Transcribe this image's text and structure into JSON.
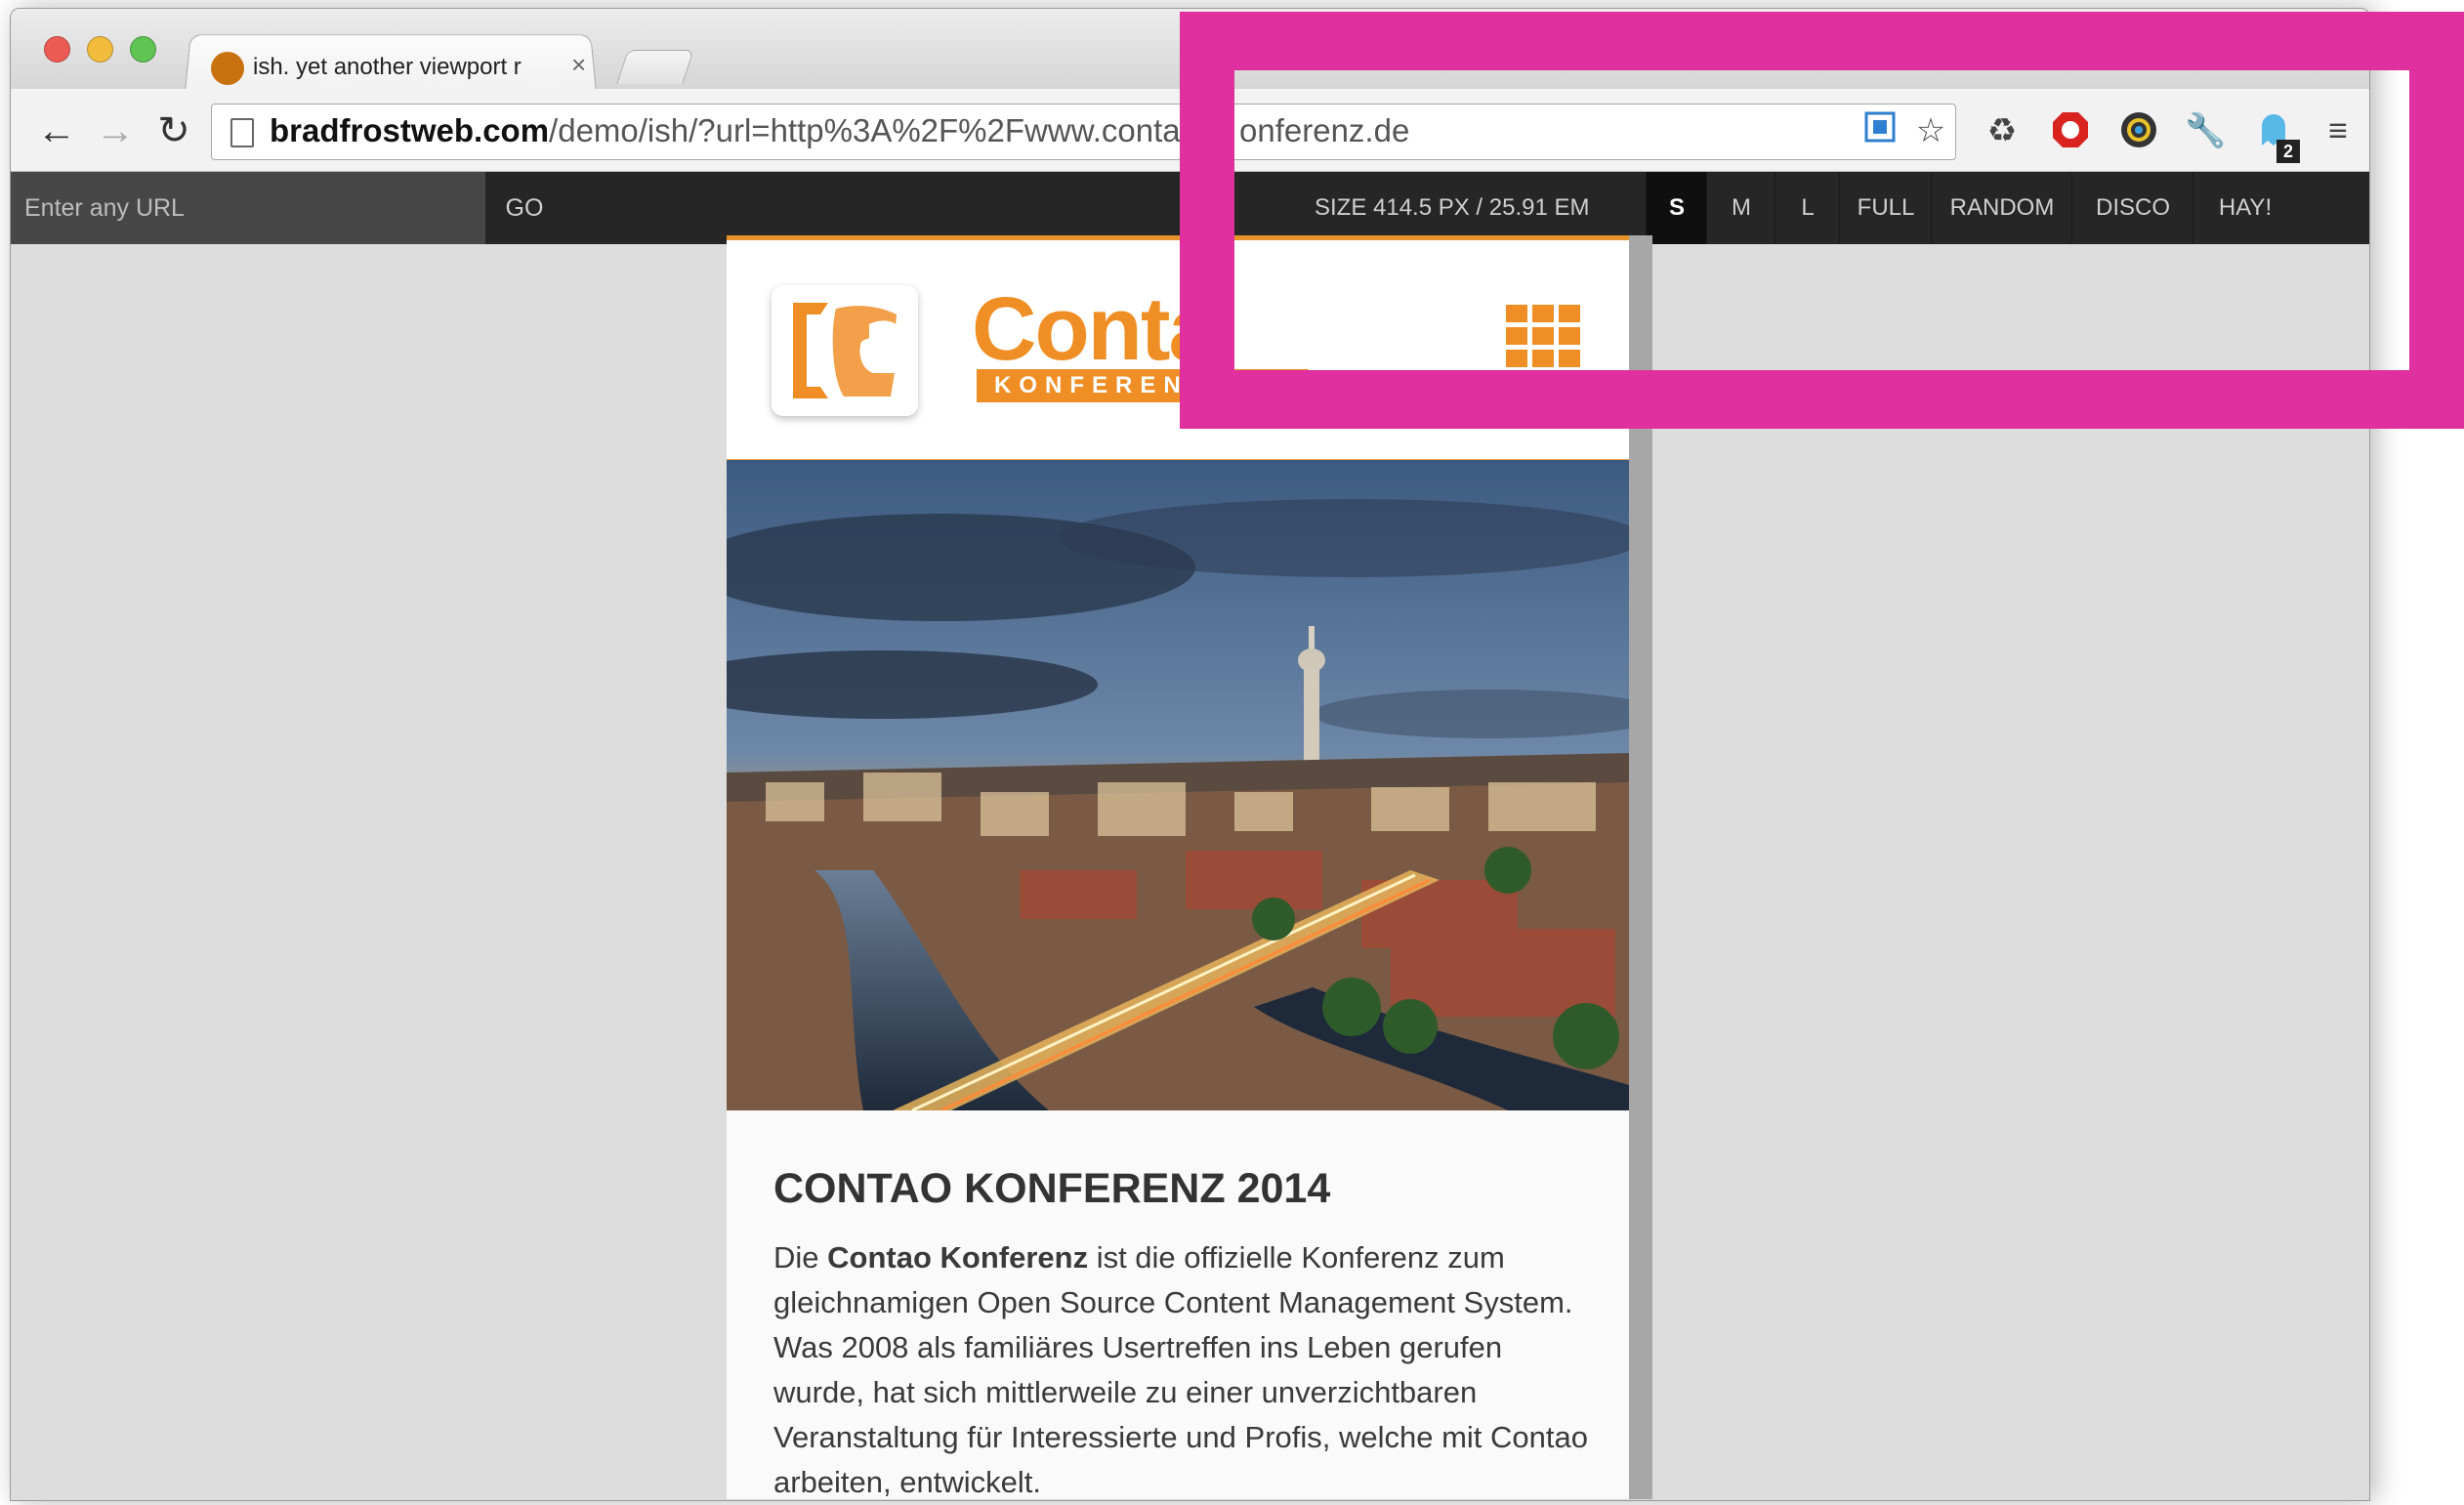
{
  "browser": {
    "tab_title": "ish. yet another viewport r",
    "url_host": "bradfrostweb.com",
    "url_path": "/demo/ish/?url=http%3A%2F%2Fwww.conta",
    "url_tail": "onferenz.de",
    "extension_badge": "2",
    "accent_color": "#e0309f"
  },
  "ish": {
    "url_placeholder": "Enter any URL",
    "go_label": "GO",
    "size_label": "SIZE 414.5 PX / 25.91 EM",
    "buttons": [
      "S",
      "M",
      "L",
      "FULL",
      "RANDOM",
      "DISCO",
      "HAY!"
    ],
    "active_button": "S"
  },
  "site": {
    "logo_text": "Conta",
    "logo_sub": "KONFEREN",
    "brand_color": "#ef8e24",
    "article_title": "CONTAO KONFERENZ 2014",
    "body_intro": "Die ",
    "body_bold": "Contao Konferenz",
    "body_rest": " ist die offizielle Konferenz zum gleichnamigen Open Source Content Management System. Was 2008 als familiäres Usertreffen ins Leben gerufen wurde, hat sich mittlerweile zu einer unverzichtbaren Veranstaltung für Interessierte und Profis, welche mit Contao arbeiten, entwickelt."
  }
}
